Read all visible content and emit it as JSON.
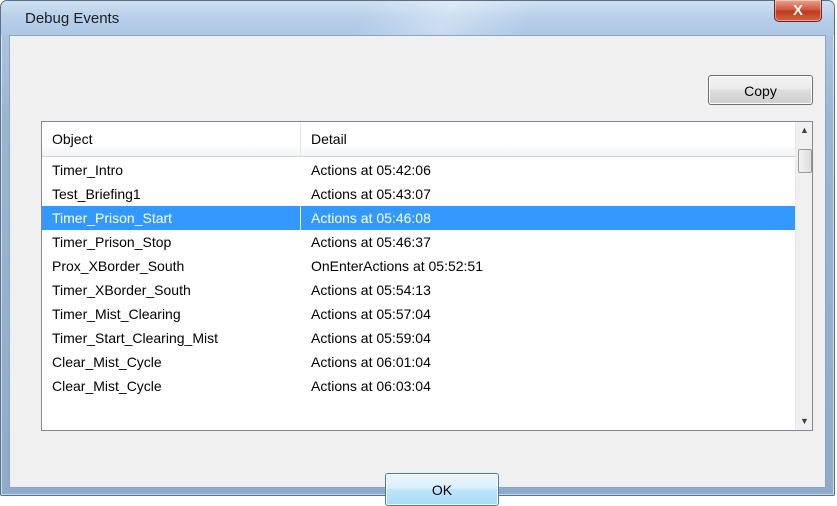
{
  "window": {
    "title": "Debug Events",
    "close_glyph": "X"
  },
  "toolbar": {
    "copy_label": "Copy"
  },
  "table": {
    "columns": [
      "Object",
      "Detail"
    ],
    "rows": [
      {
        "object": "Timer_Intro",
        "detail": "Actions at 05:42:06",
        "selected": false
      },
      {
        "object": "Test_Briefing1",
        "detail": "Actions at 05:43:07",
        "selected": false
      },
      {
        "object": "Timer_Prison_Start",
        "detail": "Actions at 05:46:08",
        "selected": true
      },
      {
        "object": "Timer_Prison_Stop",
        "detail": "Actions at 05:46:37",
        "selected": false
      },
      {
        "object": "Prox_XBorder_South",
        "detail": "OnEnterActions at 05:52:51",
        "selected": false
      },
      {
        "object": "Timer_XBorder_South",
        "detail": "Actions at 05:54:13",
        "selected": false
      },
      {
        "object": "Timer_Mist_Clearing",
        "detail": "Actions at 05:57:04",
        "selected": false
      },
      {
        "object": "Timer_Start_Clearing_Mist",
        "detail": "Actions at 05:59:04",
        "selected": false
      },
      {
        "object": "Clear_Mist_Cycle",
        "detail": "Actions at 06:01:04",
        "selected": false
      },
      {
        "object": "Clear_Mist_Cycle",
        "detail": "Actions at 06:03:04",
        "selected": false
      }
    ]
  },
  "footer": {
    "ok_label": "OK"
  },
  "colors": {
    "selection": "#3399ff",
    "close_button": "#c7452a"
  },
  "icons": {
    "close": "close-icon",
    "scroll_up": "scroll-up-arrow-icon",
    "scroll_down": "scroll-down-arrow-icon"
  }
}
